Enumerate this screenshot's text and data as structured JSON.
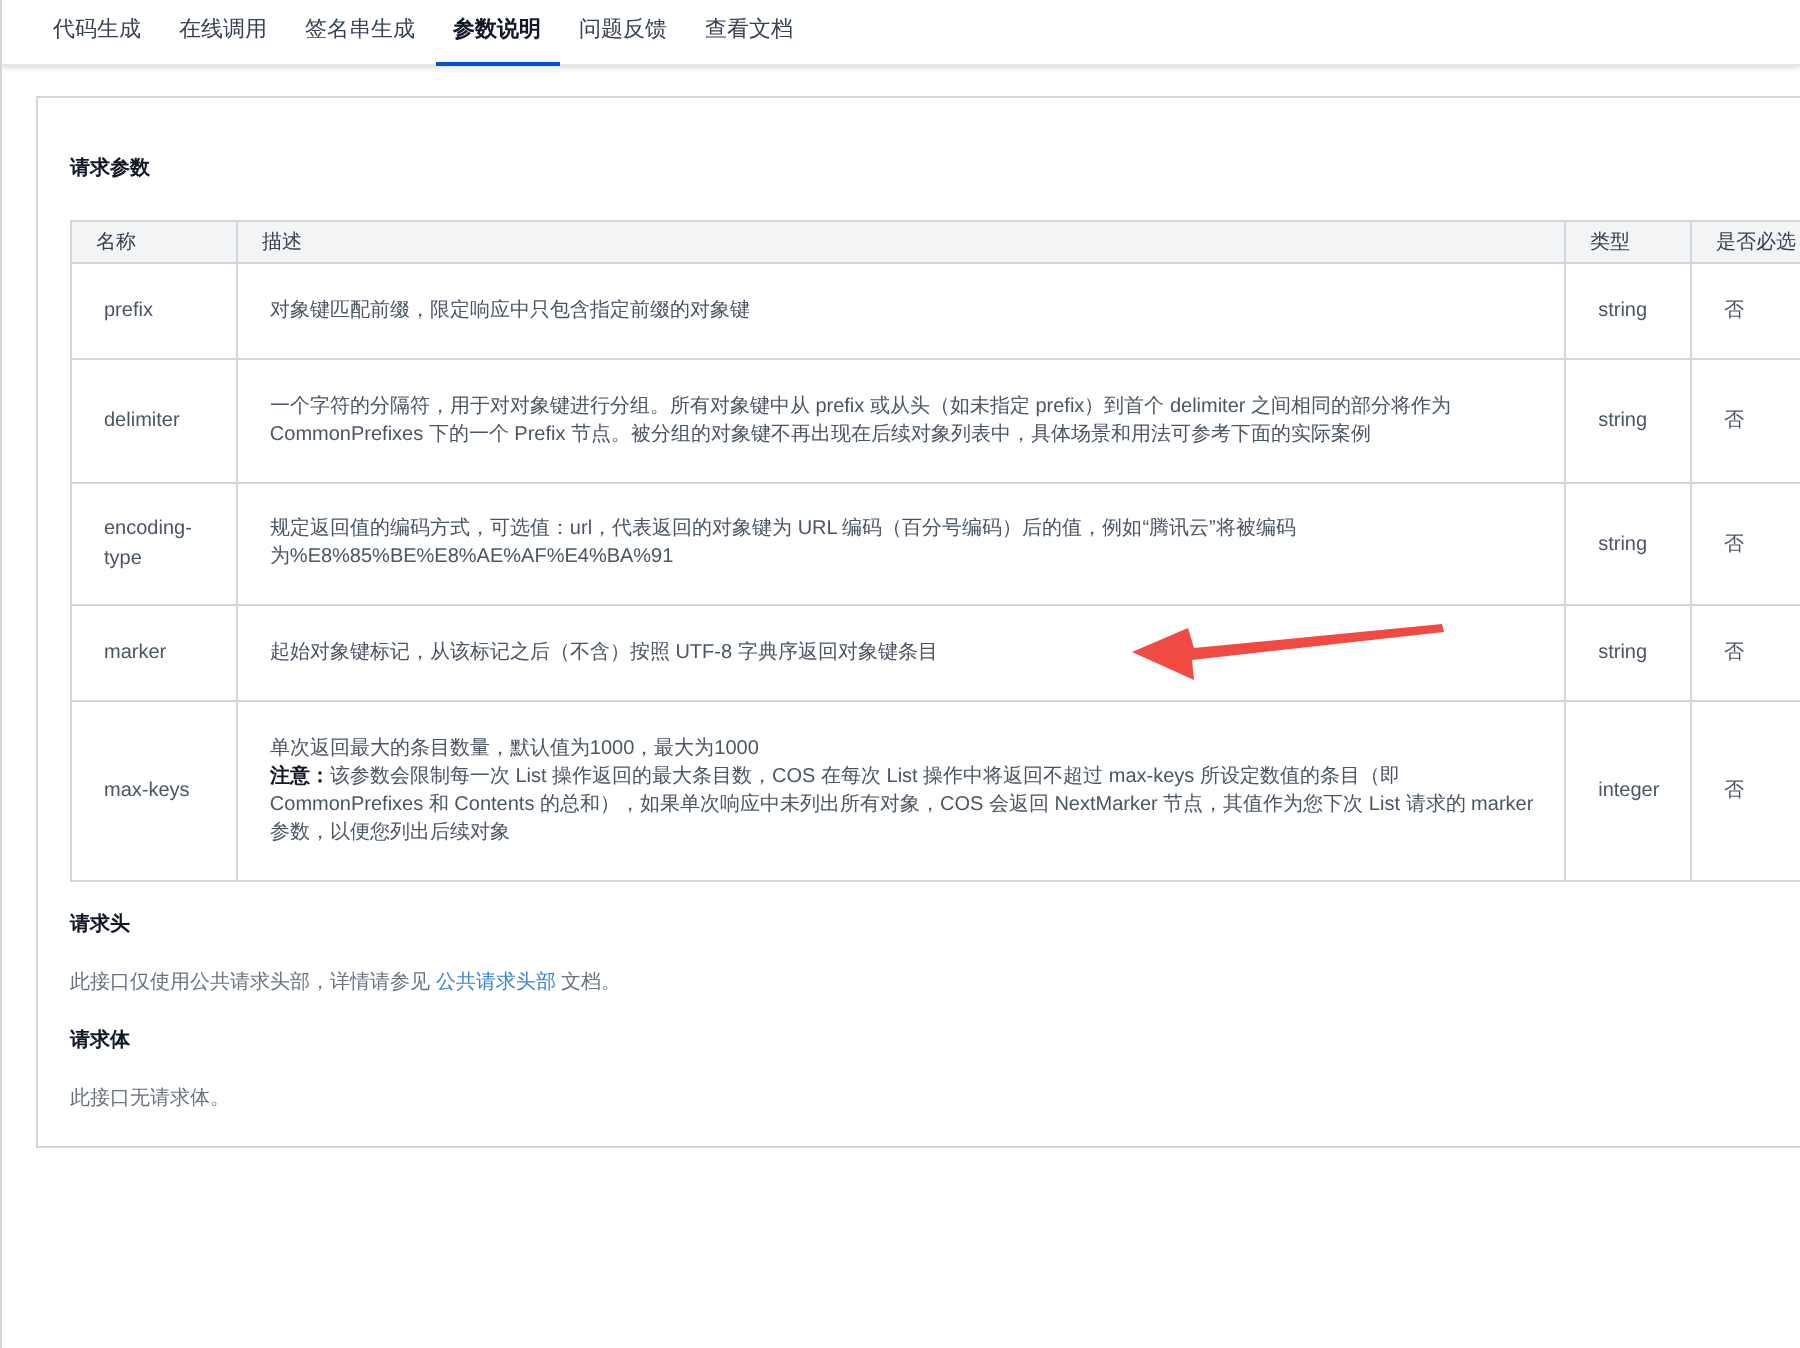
{
  "tabs": [
    {
      "label": "代码生成",
      "selected": false
    },
    {
      "label": "在线调用",
      "selected": false
    },
    {
      "label": "签名串生成",
      "selected": false
    },
    {
      "label": "参数说明",
      "selected": true
    },
    {
      "label": "问题反馈",
      "selected": false
    },
    {
      "label": "查看文档",
      "selected": false
    }
  ],
  "request_params": {
    "title": "请求参数",
    "table": {
      "columns": [
        "名称",
        "描述",
        "类型",
        "是否必选"
      ],
      "rows": [
        {
          "name": "prefix",
          "description": [
            "对象键匹配前缀，限定响应中只包含指定前缀的对象键"
          ],
          "type": "string",
          "required": "否"
        },
        {
          "name": "delimiter",
          "description": [
            "一个字符的分隔符，用于对对象键进行分组。所有对象键中从 prefix 或从头（如未指定 prefix）到首个 delimiter 之间相同的部分将作为 CommonPrefixes 下的一个 Prefix 节点。被分组的对象键不再出现在后续对象列表中，具体场景和用法可参考下面的实际案例"
          ],
          "type": "string",
          "required": "否"
        },
        {
          "name": "encoding-type",
          "description": [
            "规定返回值的编码方式，可选值：url，代表返回的对象键为 URL 编码（百分号编码）后的值，例如“腾讯云”将被编码为%E8%85%BE%E8%AE%AF%E4%BA%91"
          ],
          "type": "string",
          "required": "否"
        },
        {
          "name": "marker",
          "description": [
            "起始对象键标记，从该标记之后（不含）按照 UTF-8 字典序返回对象键条目"
          ],
          "type": "string",
          "required": "否"
        },
        {
          "name": "max-keys",
          "description": [
            "单次返回最大的条目数量，默认值为1000，最大为1000",
            "**注意：**该参数会限制每一次 List 操作返回的最大条目数，COS 在每次 List 操作中将返回不超过 max-keys 所设定数值的条目（即 CommonPrefixes 和 Contents 的总和），如果单次响应中未列出所有对象，COS 会返回 NextMarker 节点，其值作为您下次 List 请求的 marker 参数，以便您列出后续对象"
          ],
          "type": "integer",
          "required": "否"
        }
      ]
    }
  },
  "request_headers": {
    "title": "请求头",
    "text_before": "此接口仅使用公共请求头部，详情请参见",
    "link": "公共请求头部",
    "text_after": "文档。"
  },
  "request_body": {
    "title": "请求体",
    "text": "此接口无请求体。"
  }
}
